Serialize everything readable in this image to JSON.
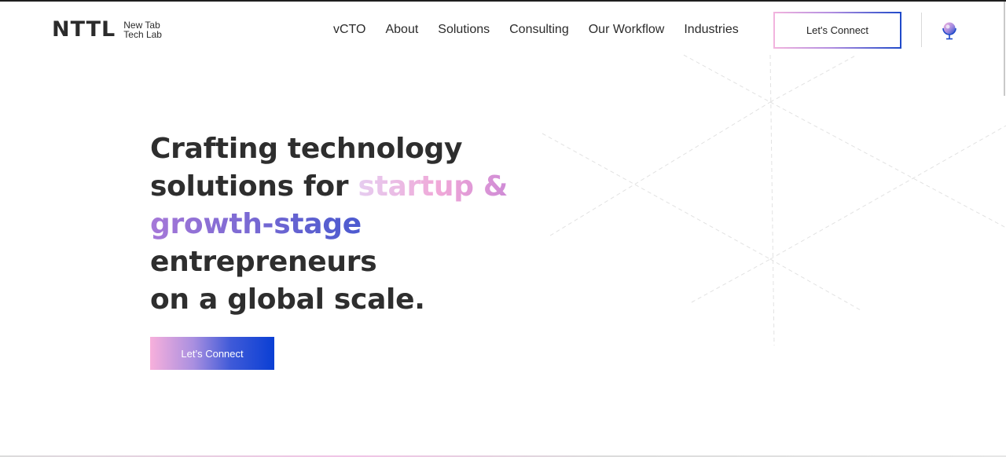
{
  "header": {
    "logo": {
      "mark": "NTTL",
      "line1": "New Tab",
      "line2": "Tech Lab"
    },
    "nav": [
      {
        "label": "vCTO"
      },
      {
        "label": "About"
      },
      {
        "label": "Solutions"
      },
      {
        "label": "Consulting"
      },
      {
        "label": "Our Workflow"
      },
      {
        "label": "Industries"
      }
    ],
    "cta_label": "Let's Connect",
    "globe_icon": "globe-pin-icon"
  },
  "hero": {
    "title": {
      "line1": "Crafting technology",
      "line2_plain": "solutions for ",
      "line2_highlight": "startup &",
      "line3_highlight": "growth-stage",
      "line4": "entrepreneurs",
      "line5": "on a global scale."
    },
    "cta_label": "Let’s Connect"
  },
  "colors": {
    "text": "#2e2e2e",
    "accent_blue": "#0a3fd4",
    "accent_pink": "#f0a8d8",
    "accent_purple": "#a678d8"
  }
}
